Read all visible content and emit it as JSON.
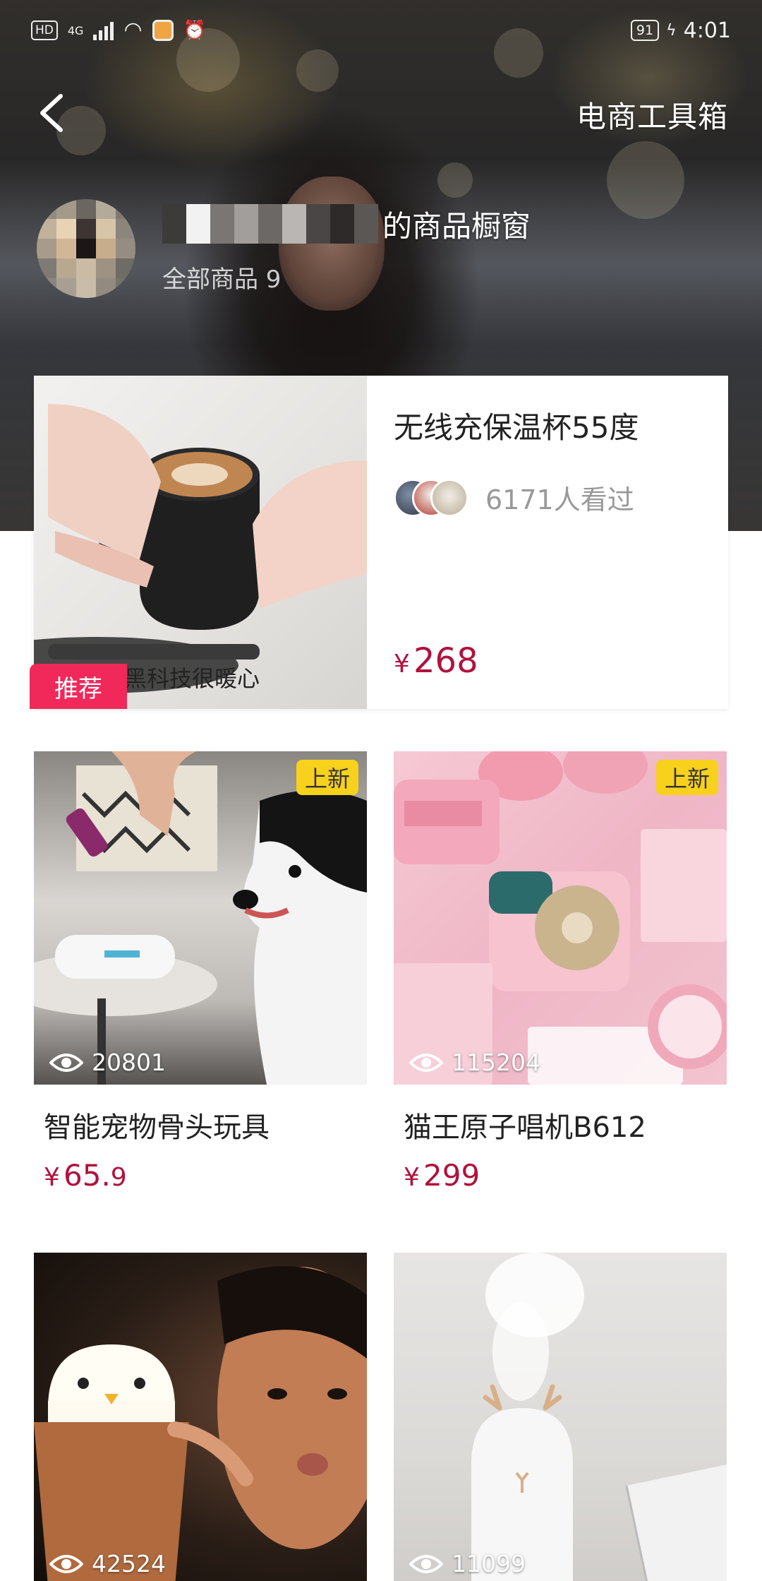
{
  "status_bar": {
    "hd": "HD",
    "network": "4G",
    "battery": "91",
    "time": "4:01"
  },
  "nav": {
    "toolbox": "电商工具箱"
  },
  "shop": {
    "title_suffix": "的商品橱窗",
    "all_products": "全部商品 9"
  },
  "featured": {
    "name": "无线充保温杯55度",
    "viewers": "6171人看过",
    "currency": "¥",
    "price": "268",
    "caption": "黑科技很暖心",
    "badge": "推荐"
  },
  "products": [
    {
      "name": "智能宠物骨头玩具",
      "views": "20801",
      "currency": "¥",
      "price_int": "65.",
      "price_dec": "9",
      "badge": "上新"
    },
    {
      "name": "猫王原子唱机B612",
      "views": "115204",
      "currency": "¥",
      "price_int": "299",
      "price_dec": "",
      "badge": "上新"
    },
    {
      "views": "42524"
    },
    {
      "views": "11099"
    }
  ],
  "colors": {
    "price": "#b0113d",
    "recommend_badge": "#f0295a",
    "new_badge": "#f7d11c"
  }
}
